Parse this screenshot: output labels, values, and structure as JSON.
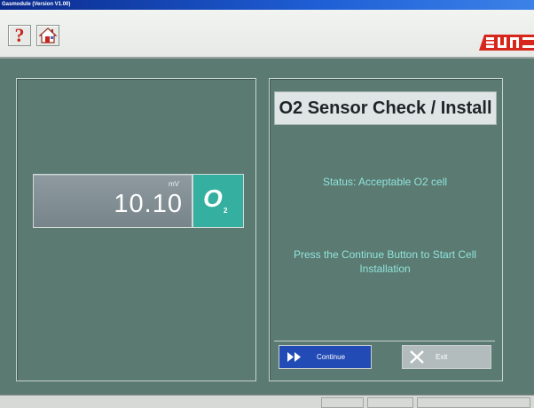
{
  "window": {
    "title": "Gasmodule (Version V1.00)"
  },
  "toolbar": {
    "help_icon": "help-question-icon",
    "home_icon": "home-icon",
    "logo_text": "Sun"
  },
  "gauge": {
    "unit": "mV",
    "value": "10.10",
    "badge_main": "O",
    "badge_sub": "2"
  },
  "panel": {
    "title": "O2 Sensor Check / Install",
    "status": "Status: Acceptable O2 cell",
    "message": "Press the Continue Button to Start Cell Installation"
  },
  "buttons": {
    "continue_label": "Continue",
    "exit_label": "Exit"
  },
  "colors": {
    "background": "#5b7a72",
    "accent_text": "#8fe3da",
    "continue": "#224bb6",
    "badge": "#35b0a0",
    "logo": "#d7261c"
  }
}
